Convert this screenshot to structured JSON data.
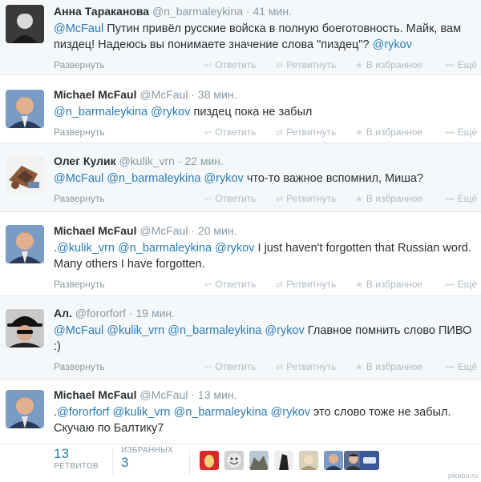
{
  "actions": {
    "expand": "Развернуть",
    "reply": "Ответить",
    "retweet": "Ретвитнуть",
    "favorite": "В избранное",
    "more": "Ещё"
  },
  "tweets": [
    {
      "name": "Анна Тараканова",
      "handle": "@n_barmaleykina",
      "time": "41 мин.",
      "parts": [
        {
          "t": "@McFaul",
          "m": true
        },
        {
          "t": " Путин привёл русские войска в полную боеготовность. Майк, вам пиздец! Надеюсь вы понимаете значение слова \"пиздец\"? ",
          "m": false
        },
        {
          "t": "@rykov",
          "m": true
        }
      ]
    },
    {
      "name": "Michael McFaul",
      "handle": "@McFaul",
      "time": "38 мин.",
      "parts": [
        {
          "t": "@n_barmaleykina",
          "m": true
        },
        {
          "t": " ",
          "m": false
        },
        {
          "t": "@rykov",
          "m": true
        },
        {
          "t": " пиздец пока не забыл",
          "m": false
        }
      ]
    },
    {
      "name": "Олег Кулик",
      "handle": "@kulik_vrn",
      "time": "22 мин.",
      "parts": [
        {
          "t": "@McFaul",
          "m": true
        },
        {
          "t": " ",
          "m": false
        },
        {
          "t": "@n_barmaleykina",
          "m": true
        },
        {
          "t": " ",
          "m": false
        },
        {
          "t": "@rykov",
          "m": true
        },
        {
          "t": " что-то важное вспомнил, Миша?",
          "m": false
        }
      ]
    },
    {
      "name": "Michael McFaul",
      "handle": "@McFaul",
      "time": "20 мин.",
      "parts": [
        {
          "t": ".",
          "m": false
        },
        {
          "t": "@kulik_vrn",
          "m": true
        },
        {
          "t": " ",
          "m": false
        },
        {
          "t": "@n_barmaleykina",
          "m": true
        },
        {
          "t": " ",
          "m": false
        },
        {
          "t": "@rykov",
          "m": true
        },
        {
          "t": " I just haven't forgotten that Russian word. Many others I have forgotten.",
          "m": false
        }
      ]
    },
    {
      "name": "Ал.",
      "handle": "@fororforf",
      "time": "19 мин.",
      "parts": [
        {
          "t": "@McFaul",
          "m": true
        },
        {
          "t": " ",
          "m": false
        },
        {
          "t": "@kulik_vrn",
          "m": true
        },
        {
          "t": " ",
          "m": false
        },
        {
          "t": "@n_barmaleykina",
          "m": true
        },
        {
          "t": " ",
          "m": false
        },
        {
          "t": "@rykov",
          "m": true
        },
        {
          "t": " Главное помнить слово ПИВО :)",
          "m": false
        }
      ]
    },
    {
      "name": "Michael McFaul",
      "handle": "@McFaul",
      "time": "13 мин.",
      "parts": [
        {
          "t": ".",
          "m": false
        },
        {
          "t": "@fororforf",
          "m": true
        },
        {
          "t": " ",
          "m": false
        },
        {
          "t": "@kulik_vrn",
          "m": true
        },
        {
          "t": " ",
          "m": false
        },
        {
          "t": "@n_barmaleykina",
          "m": true
        },
        {
          "t": " ",
          "m": false
        },
        {
          "t": "@rykov",
          "m": true
        },
        {
          "t": " это слово тоже не забыл. Скучаю по Балтику7",
          "m": false
        }
      ]
    }
  ],
  "stats": {
    "retweets_count": "13",
    "retweets_label": "РЕТВИТОВ",
    "favorites_count": "3",
    "favorites_label": "ИЗБРАННЫХ"
  },
  "watermark": "pikabu.ru"
}
